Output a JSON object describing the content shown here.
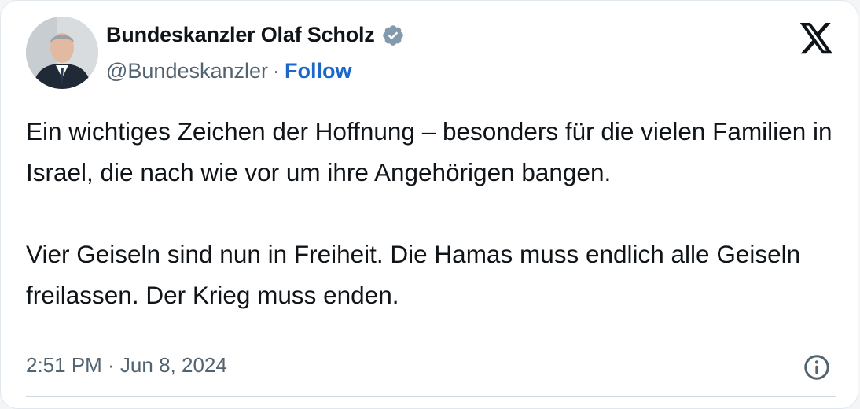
{
  "author": {
    "display_name": "Bundeskanzler Olaf Scholz",
    "handle": "@Bundeskanzler",
    "separator": "·",
    "follow_label": "Follow",
    "verified_badge_color": "#829aab"
  },
  "tweet": {
    "text": "Ein wichtiges Zeichen der Hoffnung – besonders für die vielen Familien in Israel, die nach wie vor um ihre Angehörigen bangen.\n\nVier Geiseln sind nun in Freiheit. Die Hamas muss endlich alle Geiseln freilassen. Der Krieg muss enden.",
    "timestamp": "2:51 PM · Jun 8, 2024"
  },
  "icons": {
    "brand": "x-logo-icon",
    "info": "info-icon",
    "verified": "verified-badge-icon"
  },
  "colors": {
    "link": "#1d67c9",
    "secondary_text": "#536471",
    "primary_text": "#0f1419"
  }
}
